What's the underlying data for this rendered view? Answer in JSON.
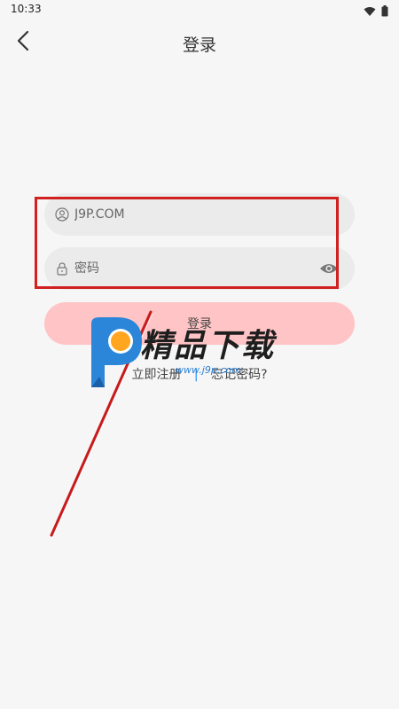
{
  "status_bar": {
    "time": "10:33"
  },
  "nav": {
    "title": "登录"
  },
  "form": {
    "username_value": "J9P.COM",
    "password_placeholder": "密码",
    "login_label": "登录"
  },
  "links": {
    "register_label": "立即注册",
    "separator": "|",
    "forgot_label": "忘记密码?"
  },
  "watermark": {
    "brand": "精品下载",
    "url": "www.j9p.com"
  },
  "colors": {
    "background": "#f6f6f6",
    "input_bg": "#ebebeb",
    "login_button_bg": "#ffc4c5",
    "annotation_red": "#d02020",
    "separator_blue": "#1a8cff"
  }
}
